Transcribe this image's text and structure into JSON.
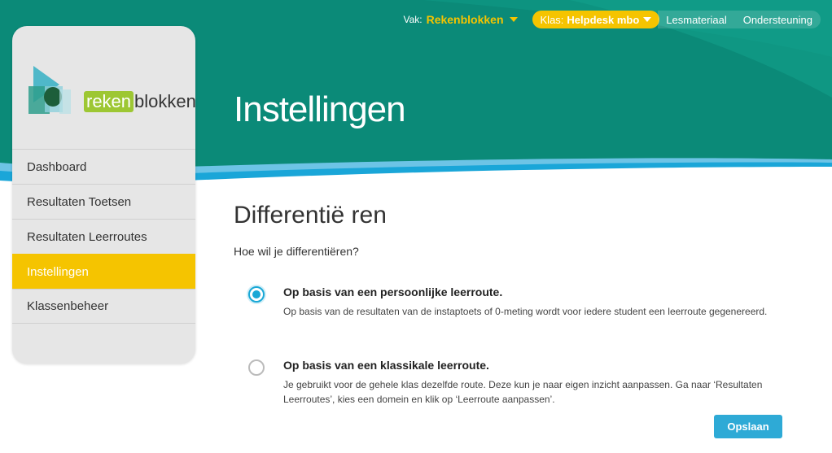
{
  "topnav": {
    "vak_label": "Vak:",
    "vak_value": "Rekenblokken",
    "klas_label": "Klas:",
    "klas_value": "Helpdesk mbo",
    "links": [
      "Lesmateriaal",
      "Ondersteuning"
    ]
  },
  "page": {
    "title": "Instellingen"
  },
  "logo": {
    "part1": "reken",
    "part2": "blokken"
  },
  "sidebar": {
    "items": [
      {
        "label": "Dashboard",
        "active": false
      },
      {
        "label": "Resultaten Toetsen",
        "active": false
      },
      {
        "label": "Resultaten Leerroutes",
        "active": false
      },
      {
        "label": "Instellingen",
        "active": true
      },
      {
        "label": "Klassenbeheer",
        "active": false
      }
    ]
  },
  "content": {
    "section_title": "Differentië ren",
    "question": "Hoe wil je differentiëren?",
    "options": [
      {
        "title": "Op basis van een persoonlijke leerroute.",
        "description": "Op basis van de resultaten van de instaptoets of 0-meting wordt voor iedere student een leerroute gegenereerd.",
        "selected": true
      },
      {
        "title": "Op basis van een klassikale leerroute.",
        "description": "Je gebruikt voor de gehele klas dezelfde route. Deze kun je naar eigen inzicht aanpassen. Ga naar ‘Resultaten Leerroutes’, kies een domein en klik op ‘Leerroute aanpassen’.",
        "selected": false
      }
    ],
    "save_label": "Opslaan"
  },
  "colors": {
    "teal": "#0b8a78",
    "yellow": "#f5c400",
    "blue": "#2eaad6"
  }
}
